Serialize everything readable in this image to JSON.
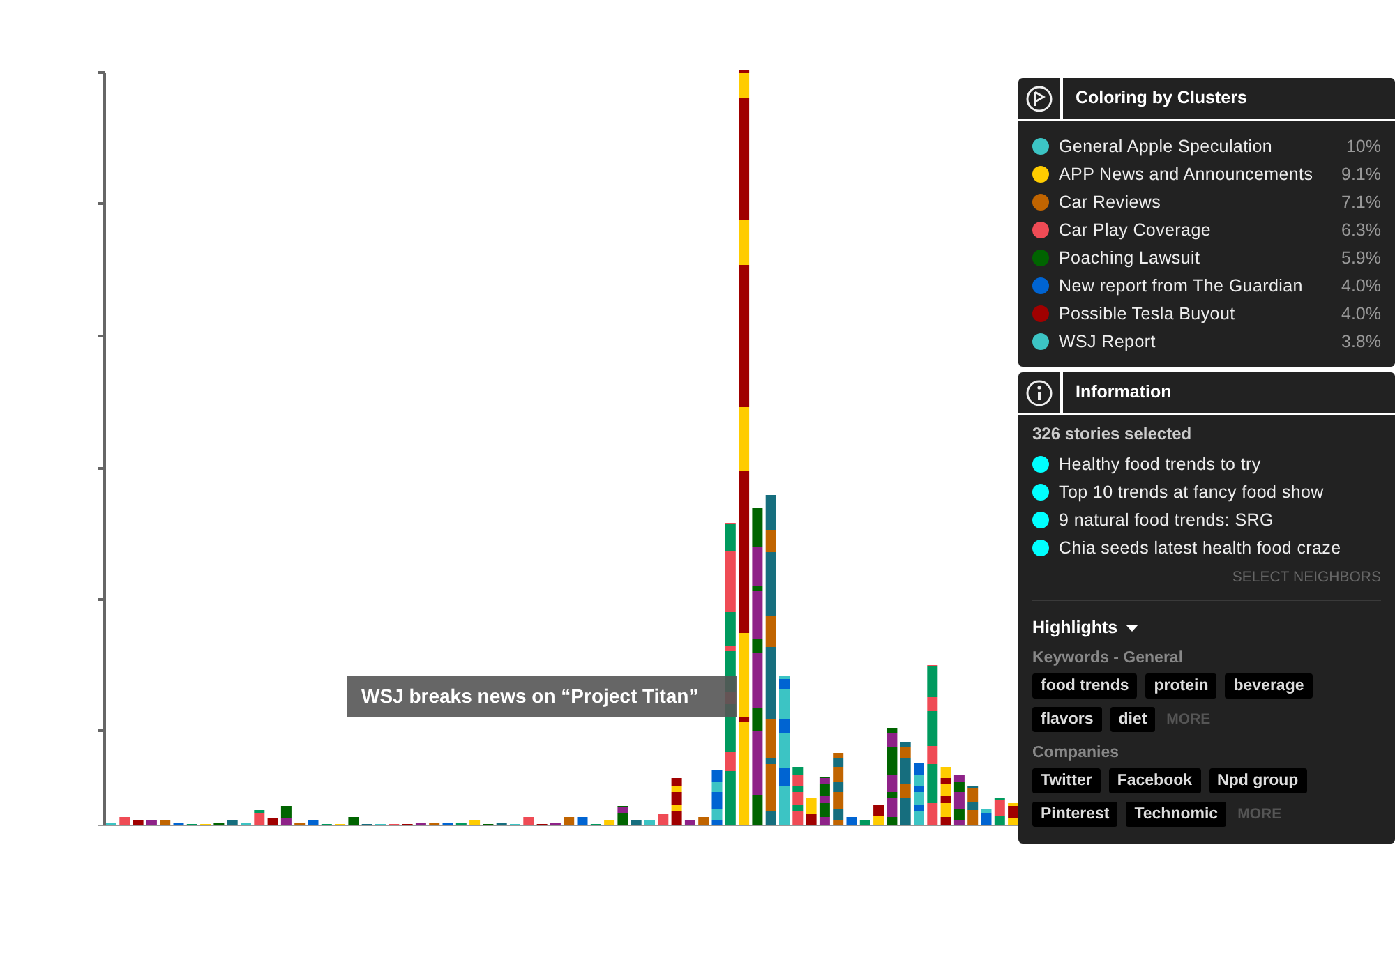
{
  "chart": {
    "tooltip": "WSJ breaks news on “Project Titan”"
  },
  "clusters_panel": {
    "title": "Coloring by Clusters",
    "items": [
      {
        "name": "General Apple Speculation",
        "share": "10%",
        "color": "#3cc4c4"
      },
      {
        "name": "APP News and Announcements",
        "share": "9.1%",
        "color": "#ffcc00"
      },
      {
        "name": "Car Reviews",
        "share": "7.1%",
        "color": "#c06400"
      },
      {
        "name": "Car Play Coverage",
        "share": "6.3%",
        "color": "#ef4b55"
      },
      {
        "name": "Poaching Lawsuit",
        "share": "5.9%",
        "color": "#006400"
      },
      {
        "name": "New report from The Guardian",
        "share": "4.0%",
        "color": "#0064d2"
      },
      {
        "name": "Possible Tesla Buyout",
        "share": "4.0%",
        "color": "#a00000"
      },
      {
        "name": "WSJ Report",
        "share": "3.8%",
        "color": "#3cc4c4"
      }
    ]
  },
  "info_panel": {
    "title": "Information",
    "count": "326 stories selected",
    "stories": [
      "Healthy food trends to try",
      "Top 10 trends at fancy food show",
      "9 natural food trends: SRG",
      "Chia seeds latest health food craze"
    ],
    "select_neighbors": "SELECT NEIGHBORS",
    "highlights": {
      "title": "Highlights",
      "groups": [
        {
          "label": "Keywords - General",
          "tags": [
            "food trends",
            "protein",
            "beverage",
            "flavors",
            "diet"
          ],
          "more": "MORE"
        },
        {
          "label": "Companies",
          "tags": [
            "Twitter",
            "Facebook",
            "Npd group",
            "Pinterest",
            "Technomic"
          ],
          "more": "MORE"
        }
      ]
    }
  }
}
